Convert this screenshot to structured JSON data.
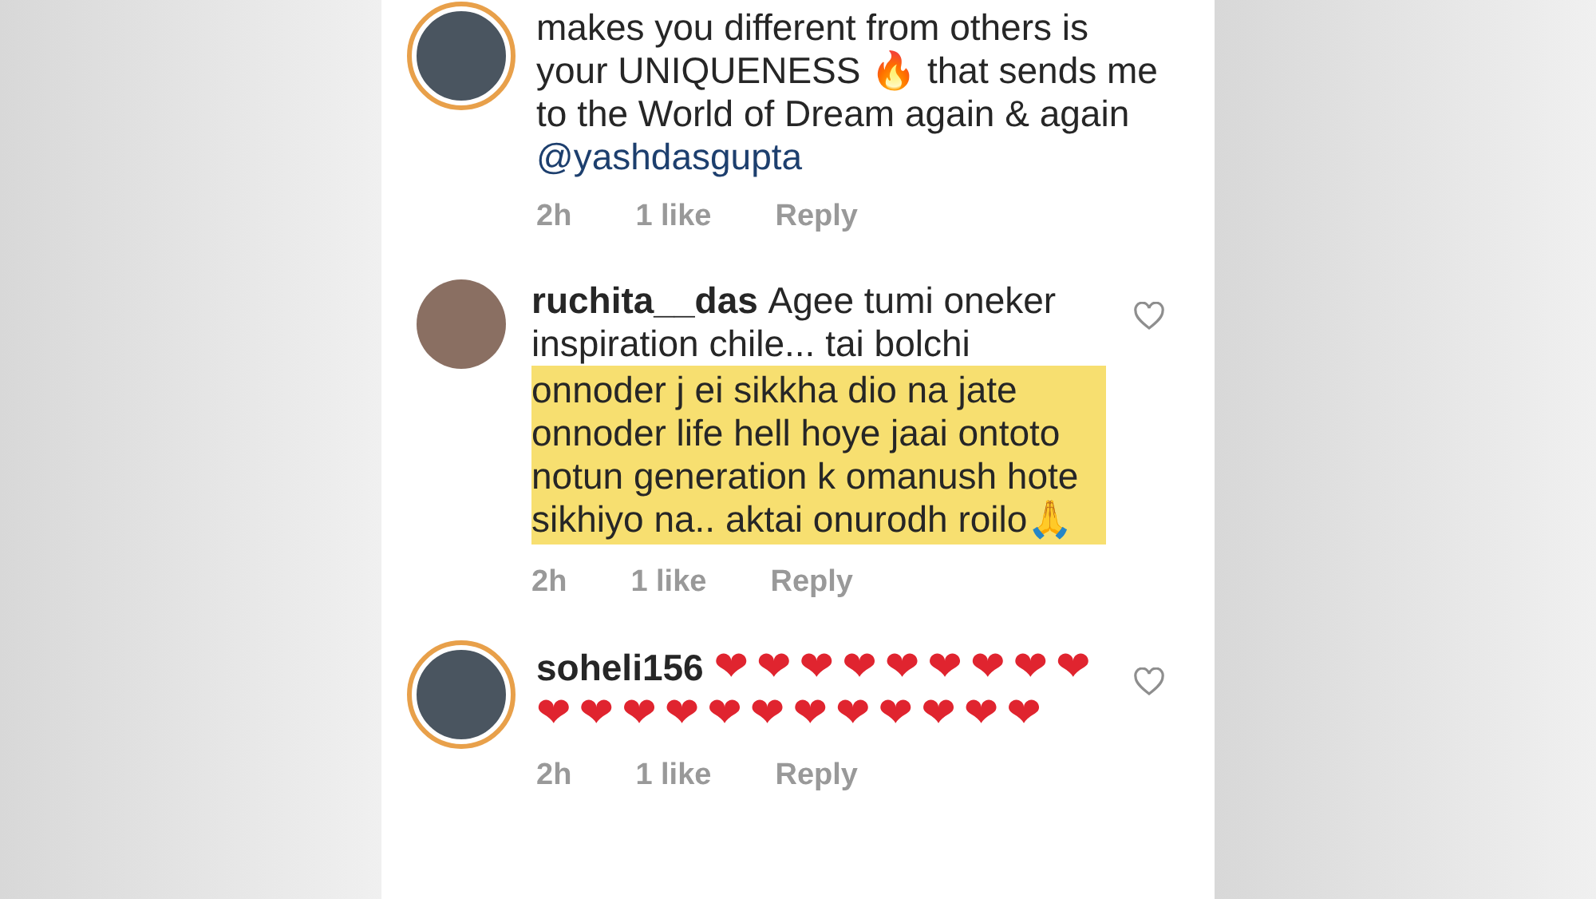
{
  "comments": [
    {
      "story_ring": true,
      "text": "makes you different from others is your UNIQUENESS 🔥 that sends me to the World of Dream again & again",
      "mention": "@yashdasgupta",
      "time": "2h",
      "likes": "1 like",
      "reply": "Reply"
    },
    {
      "story_ring": false,
      "username": "ruchita__das",
      "text": "Agee tumi oneker inspiration chile... tai bolchi",
      "highlight": "onnoder j ei sikkha dio na jate onnoder life hell hoye jaai ontoto notun generation k omanush hote sikhiyo na.. aktai onurodh roilo🙏",
      "time": "2h",
      "likes": "1 like",
      "reply": "Reply"
    },
    {
      "story_ring": true,
      "username": "soheli156",
      "text": "❤❤❤❤❤❤❤❤❤❤❤❤❤❤❤❤❤❤❤❤❤",
      "time": "2h",
      "likes": "1 like",
      "reply": "Reply"
    }
  ]
}
